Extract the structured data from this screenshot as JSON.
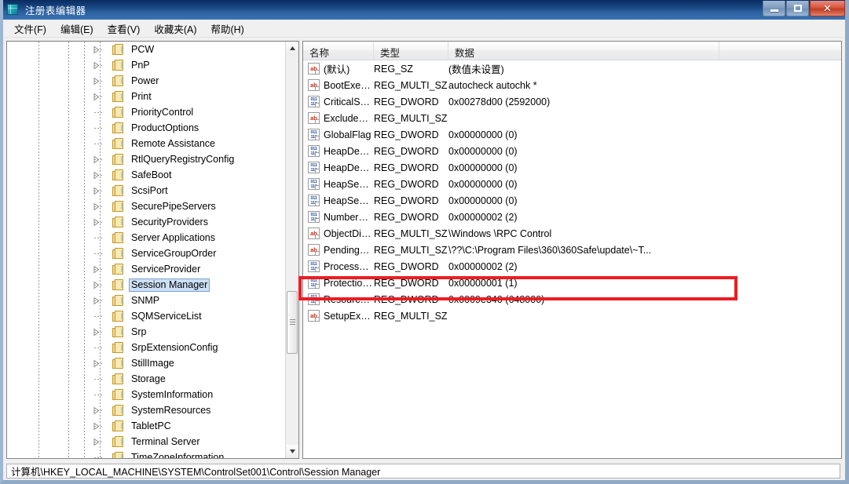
{
  "window": {
    "title": "注册表编辑器",
    "icon": "regedit-cube-icon",
    "controls": {
      "minimize": "—",
      "restore": "❐",
      "close": "✕"
    }
  },
  "menubar": {
    "items": [
      {
        "label": "文件(F)",
        "name": "menu-file"
      },
      {
        "label": "编辑(E)",
        "name": "menu-edit"
      },
      {
        "label": "查看(V)",
        "name": "menu-view"
      },
      {
        "label": "收藏夹(A)",
        "name": "menu-favorites"
      },
      {
        "label": "帮助(H)",
        "name": "menu-help"
      }
    ]
  },
  "tree": {
    "items": [
      {
        "label": "PCW",
        "expandable": true,
        "selected": false
      },
      {
        "label": "PnP",
        "expandable": true,
        "selected": false
      },
      {
        "label": "Power",
        "expandable": true,
        "selected": false
      },
      {
        "label": "Print",
        "expandable": true,
        "selected": false
      },
      {
        "label": "PriorityControl",
        "expandable": false,
        "selected": false
      },
      {
        "label": "ProductOptions",
        "expandable": false,
        "selected": false
      },
      {
        "label": "Remote Assistance",
        "expandable": false,
        "selected": false
      },
      {
        "label": "RtlQueryRegistryConfig",
        "expandable": true,
        "selected": false
      },
      {
        "label": "SafeBoot",
        "expandable": true,
        "selected": false
      },
      {
        "label": "ScsiPort",
        "expandable": true,
        "selected": false
      },
      {
        "label": "SecurePipeServers",
        "expandable": true,
        "selected": false
      },
      {
        "label": "SecurityProviders",
        "expandable": true,
        "selected": false
      },
      {
        "label": "Server Applications",
        "expandable": false,
        "selected": false
      },
      {
        "label": "ServiceGroupOrder",
        "expandable": false,
        "selected": false
      },
      {
        "label": "ServiceProvider",
        "expandable": true,
        "selected": false
      },
      {
        "label": "Session Manager",
        "expandable": true,
        "selected": true
      },
      {
        "label": "SNMP",
        "expandable": true,
        "selected": false
      },
      {
        "label": "SQMServiceList",
        "expandable": false,
        "selected": false
      },
      {
        "label": "Srp",
        "expandable": true,
        "selected": false
      },
      {
        "label": "SrpExtensionConfig",
        "expandable": false,
        "selected": false
      },
      {
        "label": "StillImage",
        "expandable": true,
        "selected": false
      },
      {
        "label": "Storage",
        "expandable": false,
        "selected": false
      },
      {
        "label": "SystemInformation",
        "expandable": false,
        "selected": false
      },
      {
        "label": "SystemResources",
        "expandable": true,
        "selected": false
      },
      {
        "label": "TabletPC",
        "expandable": true,
        "selected": false
      },
      {
        "label": "Terminal Server",
        "expandable": true,
        "selected": false
      },
      {
        "label": "TimeZoneInformation",
        "expandable": false,
        "selected": false
      }
    ]
  },
  "list": {
    "columns": [
      {
        "label": "名称",
        "name": "column-name"
      },
      {
        "label": "类型",
        "name": "column-type"
      },
      {
        "label": "数据",
        "name": "column-data"
      },
      {
        "label": "",
        "name": "column-filler"
      }
    ],
    "rows": [
      {
        "name": "(默认)",
        "icon": "string-value-icon",
        "type": "REG_SZ",
        "data": "(数值未设置)",
        "highlighted": false
      },
      {
        "name": "BootExecute",
        "icon": "string-value-icon",
        "type": "REG_MULTI_SZ",
        "data": "autocheck autochk *",
        "highlighted": false
      },
      {
        "name": "CriticalSection...",
        "icon": "dword-value-icon",
        "type": "REG_DWORD",
        "data": "0x00278d00 (2592000)",
        "highlighted": false
      },
      {
        "name": "ExcludeFromK...",
        "icon": "string-value-icon",
        "type": "REG_MULTI_SZ",
        "data": "",
        "highlighted": false
      },
      {
        "name": "GlobalFlag",
        "icon": "dword-value-icon",
        "type": "REG_DWORD",
        "data": "0x00000000 (0)",
        "highlighted": false
      },
      {
        "name": "HeapDeComm...",
        "icon": "dword-value-icon",
        "type": "REG_DWORD",
        "data": "0x00000000 (0)",
        "highlighted": false
      },
      {
        "name": "HeapDeComm...",
        "icon": "dword-value-icon",
        "type": "REG_DWORD",
        "data": "0x00000000 (0)",
        "highlighted": false
      },
      {
        "name": "HeapSegment...",
        "icon": "dword-value-icon",
        "type": "REG_DWORD",
        "data": "0x00000000 (0)",
        "highlighted": false
      },
      {
        "name": "HeapSegment...",
        "icon": "dword-value-icon",
        "type": "REG_DWORD",
        "data": "0x00000000 (0)",
        "highlighted": false
      },
      {
        "name": "NumberOfIniti...",
        "icon": "dword-value-icon",
        "type": "REG_DWORD",
        "data": "0x00000002 (2)",
        "highlighted": false
      },
      {
        "name": "ObjectDirector...",
        "icon": "string-value-icon",
        "type": "REG_MULTI_SZ",
        "data": "\\Windows \\RPC Control",
        "highlighted": false
      },
      {
        "name": "PendingFileRe...",
        "icon": "string-value-icon",
        "type": "REG_MULTI_SZ",
        "data": "\\??\\C:\\Program Files\\360\\360Safe\\update\\~T...",
        "highlighted": true
      },
      {
        "name": "ProcessorCont...",
        "icon": "dword-value-icon",
        "type": "REG_DWORD",
        "data": "0x00000002 (2)",
        "highlighted": false
      },
      {
        "name": "ProtectionMode",
        "icon": "dword-value-icon",
        "type": "REG_DWORD",
        "data": "0x00000001 (1)",
        "highlighted": false
      },
      {
        "name": "ResourceTime...",
        "icon": "dword-value-icon",
        "type": "REG_DWORD",
        "data": "0x0009e340 (648000)",
        "highlighted": false
      },
      {
        "name": "SetupExecute",
        "icon": "string-value-icon",
        "type": "REG_MULTI_SZ",
        "data": "",
        "highlighted": false
      }
    ]
  },
  "annotation": {
    "color": "#ee1c23",
    "target_row": "PendingFileRe..."
  },
  "statusbar": {
    "path": "计算机\\HKEY_LOCAL_MACHINE\\SYSTEM\\ControlSet001\\Control\\Session Manager"
  },
  "icons": {
    "string_glyph": "ab",
    "dword_glyph_top": "011",
    "dword_glyph_bottom": "110"
  }
}
